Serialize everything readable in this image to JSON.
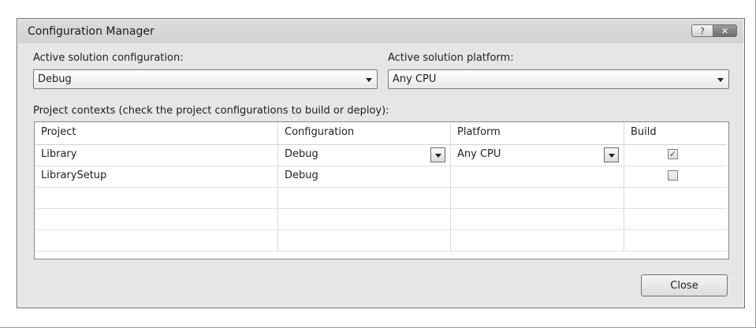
{
  "dialog": {
    "title": "Configuration Manager",
    "help_glyph": "?",
    "close_glyph": "✕"
  },
  "active_config": {
    "label": "Active solution configuration:",
    "value": "Debug"
  },
  "active_platform": {
    "label": "Active solution platform:",
    "value": "Any CPU"
  },
  "contexts": {
    "label": "Project contexts (check the project configurations to build or deploy):",
    "columns": [
      "Project",
      "Configuration",
      "Platform",
      "Build"
    ],
    "rows": [
      {
        "project": "Library",
        "configuration": "Debug",
        "platform": "Any CPU",
        "build": true
      },
      {
        "project": "LibrarySetup",
        "configuration": "Debug",
        "platform": "",
        "build": false
      }
    ]
  },
  "buttons": {
    "close": "Close"
  },
  "icons": {
    "dropdown": "chevron-down-icon",
    "help": "help-icon",
    "close": "close-icon",
    "checkbox": "checkbox"
  },
  "check_glyph": "✓"
}
